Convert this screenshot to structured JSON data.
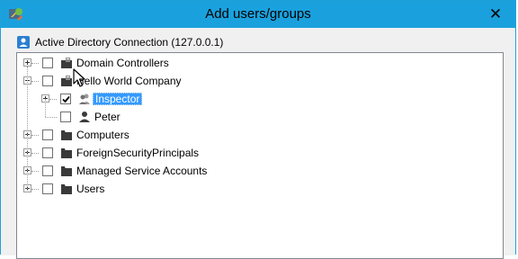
{
  "window": {
    "title": "Add users/groups",
    "close_glyph": "✕"
  },
  "connection": {
    "label": "Active Directory Connection (127.0.0.1)",
    "icon": "active-directory-icon"
  },
  "tree": {
    "nodes": [
      {
        "label": "Domain Controllers",
        "level": 0,
        "checked": false,
        "expandable": true,
        "expanded": false,
        "icon": "container-icon"
      },
      {
        "label": "Hello World Company",
        "level": 0,
        "checked": false,
        "expandable": true,
        "expanded": true,
        "icon": "container-icon"
      },
      {
        "label": "Inspector",
        "level": 1,
        "checked": true,
        "expandable": true,
        "expanded": false,
        "icon": "group-icon",
        "selected": true
      },
      {
        "label": "Peter",
        "level": 1,
        "checked": false,
        "expandable": false,
        "icon": "user-icon"
      },
      {
        "label": "Computers",
        "level": 0,
        "checked": false,
        "expandable": true,
        "expanded": false,
        "icon": "folder-icon"
      },
      {
        "label": "ForeignSecurityPrincipals",
        "level": 0,
        "checked": false,
        "expandable": true,
        "expanded": false,
        "icon": "folder-icon"
      },
      {
        "label": "Managed Service Accounts",
        "level": 0,
        "checked": false,
        "expandable": true,
        "expanded": false,
        "icon": "folder-icon"
      },
      {
        "label": "Users",
        "level": 0,
        "checked": false,
        "expandable": true,
        "expanded": false,
        "icon": "folder-icon"
      }
    ]
  },
  "colors": {
    "titlebar": "#1aa1dd",
    "selection": "#3399ff",
    "dialog_bg": "#f0f0f0"
  }
}
